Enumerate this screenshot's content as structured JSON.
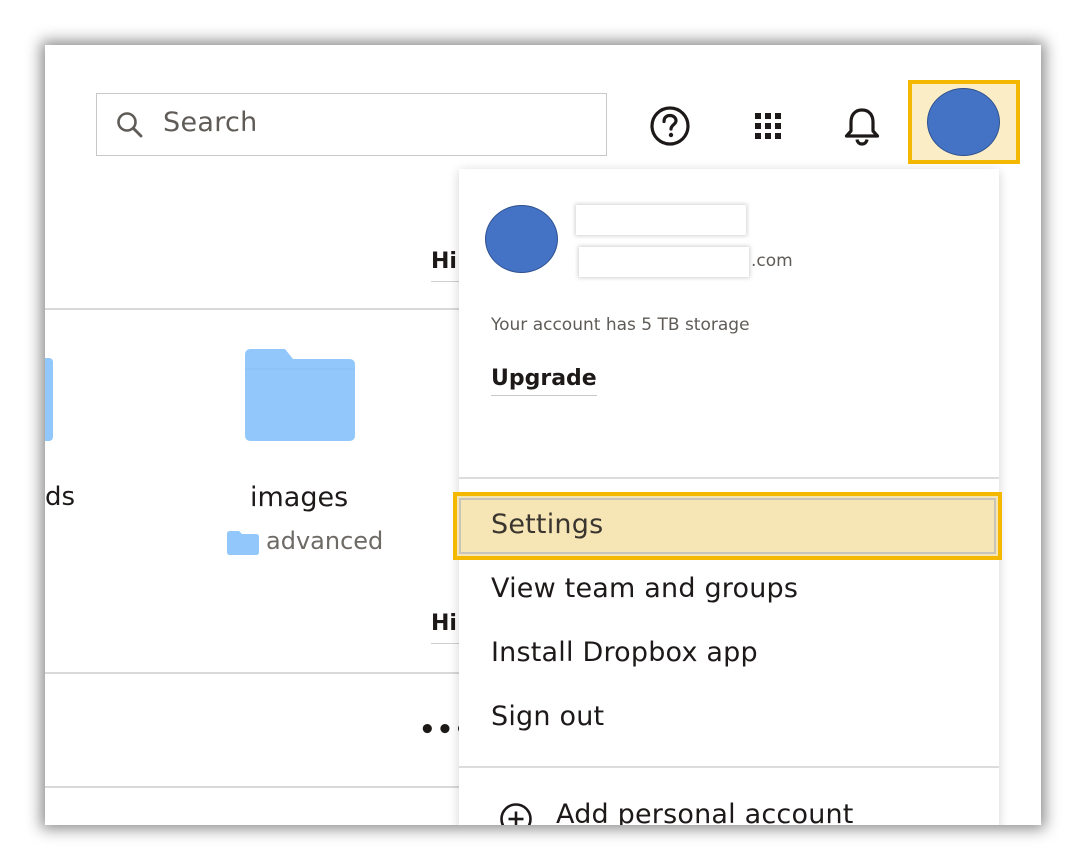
{
  "search": {
    "placeholder": "Search"
  },
  "topbar": {
    "icons": [
      "help-icon",
      "apps-grid-icon",
      "bell-icon",
      "account-avatar"
    ],
    "avatar_color": "#4472c4"
  },
  "background": {
    "partial_folder_name": "ds",
    "folder": {
      "name": "images",
      "location": "advanced",
      "color": "#92c7fb"
    },
    "truncated_labels": [
      "Hi",
      "Hi"
    ],
    "more_label": "•••"
  },
  "account_menu": {
    "email_suffix": ".com",
    "storage_text": "Your account has 5 TB storage",
    "upgrade_label": "Upgrade",
    "items": [
      {
        "label": "Settings",
        "highlighted": true
      },
      {
        "label": "View team and groups"
      },
      {
        "label": "Install Dropbox app"
      },
      {
        "label": "Sign out"
      }
    ],
    "add_account_label": "Add personal account"
  },
  "colors": {
    "highlight_border": "#f5b800",
    "highlight_fill": "#f7e6b5",
    "text": "#1e1919"
  }
}
